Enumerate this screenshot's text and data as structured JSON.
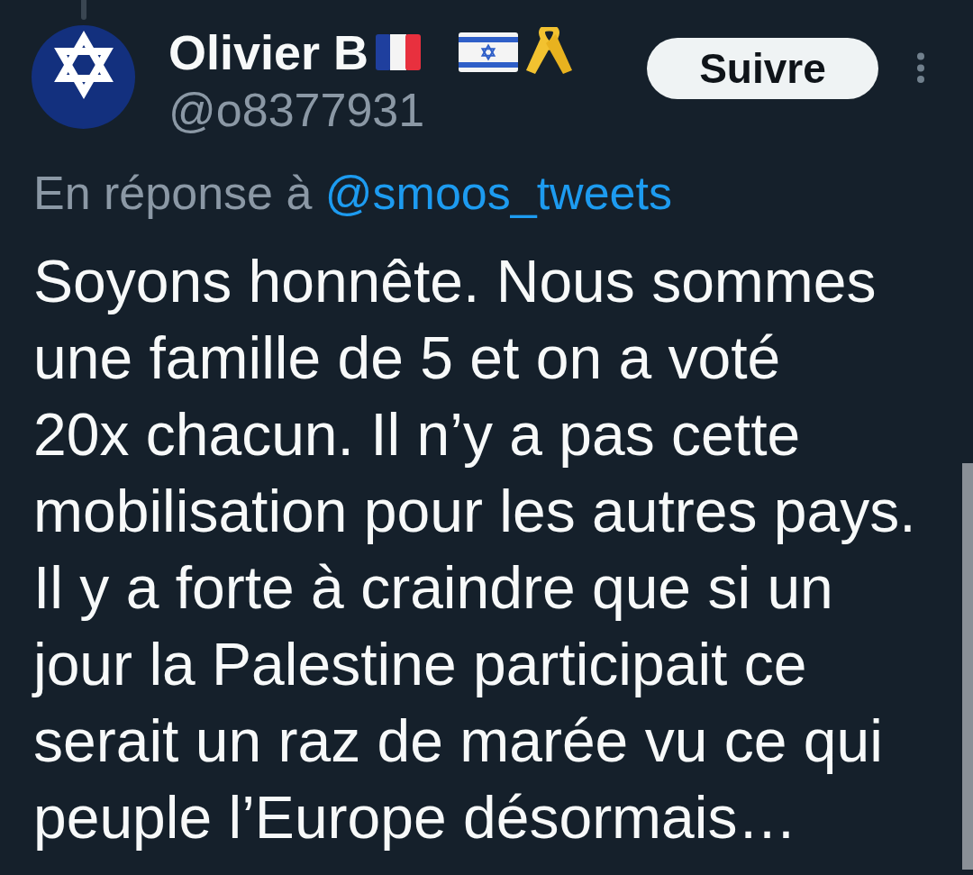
{
  "author": {
    "name": "Olivier B",
    "handle": "@o8377931"
  },
  "follow_button": {
    "label": "Suivre"
  },
  "reply_to": {
    "prefix": "En réponse à",
    "mention": "@smoos_tweets"
  },
  "tweet": {
    "text_lines": [
      "Soyons honnête. Nous sommes",
      "une famille de 5 et on a voté",
      "20x chacun. Il n’y a pas cette",
      "mobilisation pour les autres pays.",
      "Il y a forte à craindre que si un",
      "jour la Palestine participait ce",
      "serait un raz de marée vu ce qui",
      "peuple l’Europe désormais…"
    ]
  }
}
